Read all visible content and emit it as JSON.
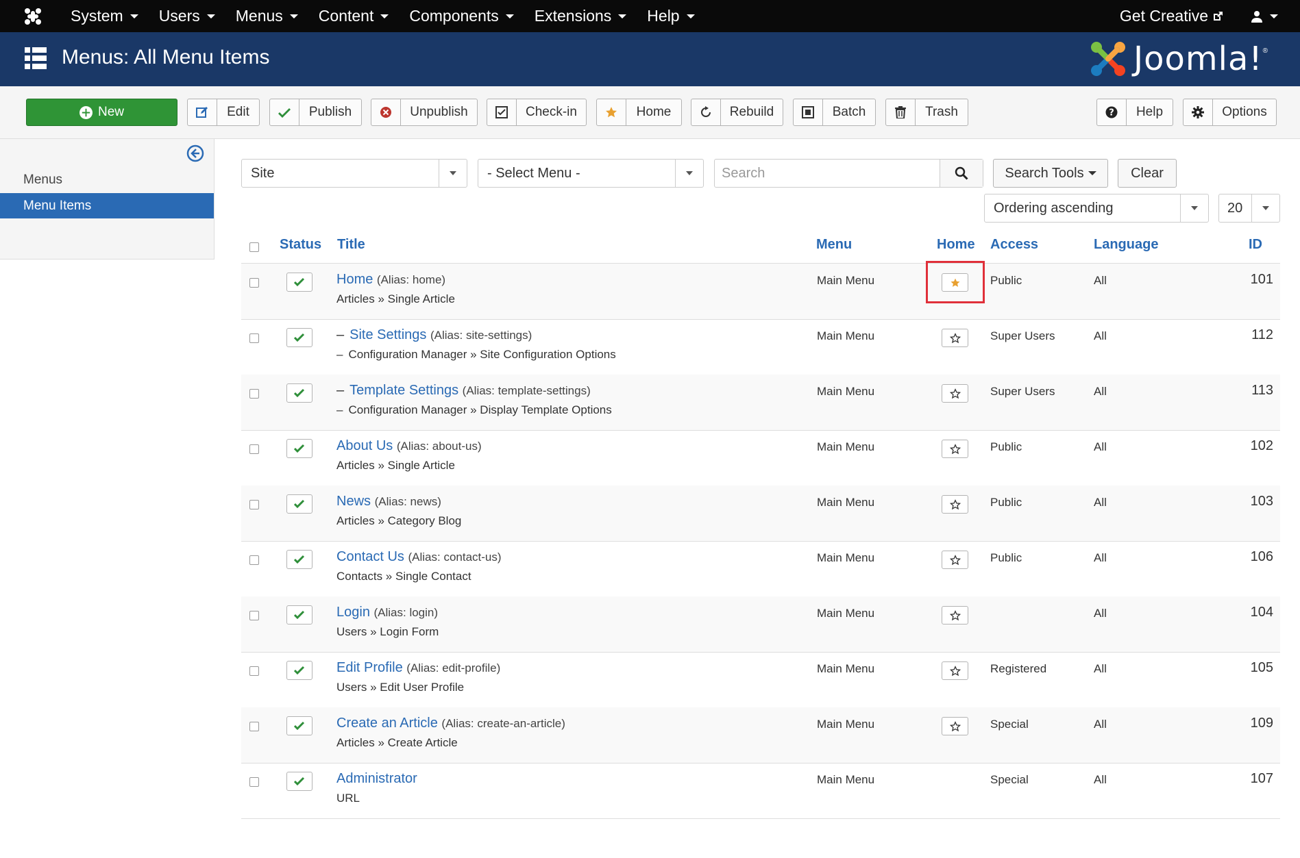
{
  "topnav": {
    "items": [
      {
        "label": "System"
      },
      {
        "label": "Users"
      },
      {
        "label": "Menus"
      },
      {
        "label": "Content"
      },
      {
        "label": "Components"
      },
      {
        "label": "Extensions"
      },
      {
        "label": "Help"
      }
    ],
    "get_creative": "Get Creative"
  },
  "header": {
    "title": "Menus: All Menu Items",
    "brand": "Joomla!"
  },
  "toolbar": {
    "new": "New",
    "edit": "Edit",
    "publish": "Publish",
    "unpublish": "Unpublish",
    "checkin": "Check-in",
    "home": "Home",
    "rebuild": "Rebuild",
    "batch": "Batch",
    "trash": "Trash",
    "help": "Help",
    "options": "Options"
  },
  "sidebar": {
    "items": [
      {
        "label": "Menus"
      },
      {
        "label": "Menu Items"
      }
    ]
  },
  "filters": {
    "client": "Site",
    "menu": "- Select Menu -",
    "search_placeholder": "Search",
    "search_tools": "Search Tools",
    "clear": "Clear",
    "ordering": "Ordering ascending",
    "limit": "20"
  },
  "table": {
    "headers": {
      "status": "Status",
      "title": "Title",
      "menu": "Menu",
      "home": "Home",
      "access": "Access",
      "language": "Language",
      "id": "ID"
    },
    "rows": [
      {
        "title": "Home",
        "alias": "(Alias: home)",
        "type": "Articles » Single Article",
        "menu": "Main Menu",
        "home": true,
        "access": "Public",
        "language": "All",
        "id": "101",
        "child": false
      },
      {
        "title": "Site Settings",
        "alias": "(Alias: site-settings)",
        "type": "Configuration Manager » Site Configuration Options",
        "menu": "Main Menu",
        "home": false,
        "access": "Super Users",
        "language": "All",
        "id": "112",
        "child": true
      },
      {
        "title": "Template Settings",
        "alias": "(Alias: template-settings)",
        "type": "Configuration Manager » Display Template Options",
        "menu": "Main Menu",
        "home": false,
        "access": "Super Users",
        "language": "All",
        "id": "113",
        "child": true
      },
      {
        "title": "About Us",
        "alias": "(Alias: about-us)",
        "type": "Articles » Single Article",
        "menu": "Main Menu",
        "home": false,
        "access": "Public",
        "language": "All",
        "id": "102",
        "child": false
      },
      {
        "title": "News",
        "alias": "(Alias: news)",
        "type": "Articles » Category Blog",
        "menu": "Main Menu",
        "home": false,
        "access": "Public",
        "language": "All",
        "id": "103",
        "child": false
      },
      {
        "title": "Contact Us",
        "alias": "(Alias: contact-us)",
        "type": "Contacts » Single Contact",
        "menu": "Main Menu",
        "home": false,
        "access": "Public",
        "language": "All",
        "id": "106",
        "child": false
      },
      {
        "title": "Login",
        "alias": "(Alias: login)",
        "type": "Users » Login Form",
        "menu": "Main Menu",
        "home": false,
        "access": "",
        "language": "All",
        "id": "104",
        "child": false
      },
      {
        "title": "Edit Profile",
        "alias": "(Alias: edit-profile)",
        "type": "Users » Edit User Profile",
        "menu": "Main Menu",
        "home": false,
        "access": "Registered",
        "language": "All",
        "id": "105",
        "child": false
      },
      {
        "title": "Create an Article",
        "alias": "(Alias: create-an-article)",
        "type": "Articles » Create Article",
        "menu": "Main Menu",
        "home": false,
        "access": "Special",
        "language": "All",
        "id": "109",
        "child": false
      },
      {
        "title": "Administrator",
        "alias": "",
        "type": "URL",
        "menu": "Main Menu",
        "home": null,
        "access": "Special",
        "language": "All",
        "id": "107",
        "child": false
      }
    ]
  },
  "colors": {
    "topbar": "#0a0a0a",
    "header": "#1a3867",
    "accent": "#2a6ab4",
    "new_button": "#2f9436",
    "check": "#2f8f3a",
    "star": "#e8a030",
    "highlight": "#e0303a"
  }
}
